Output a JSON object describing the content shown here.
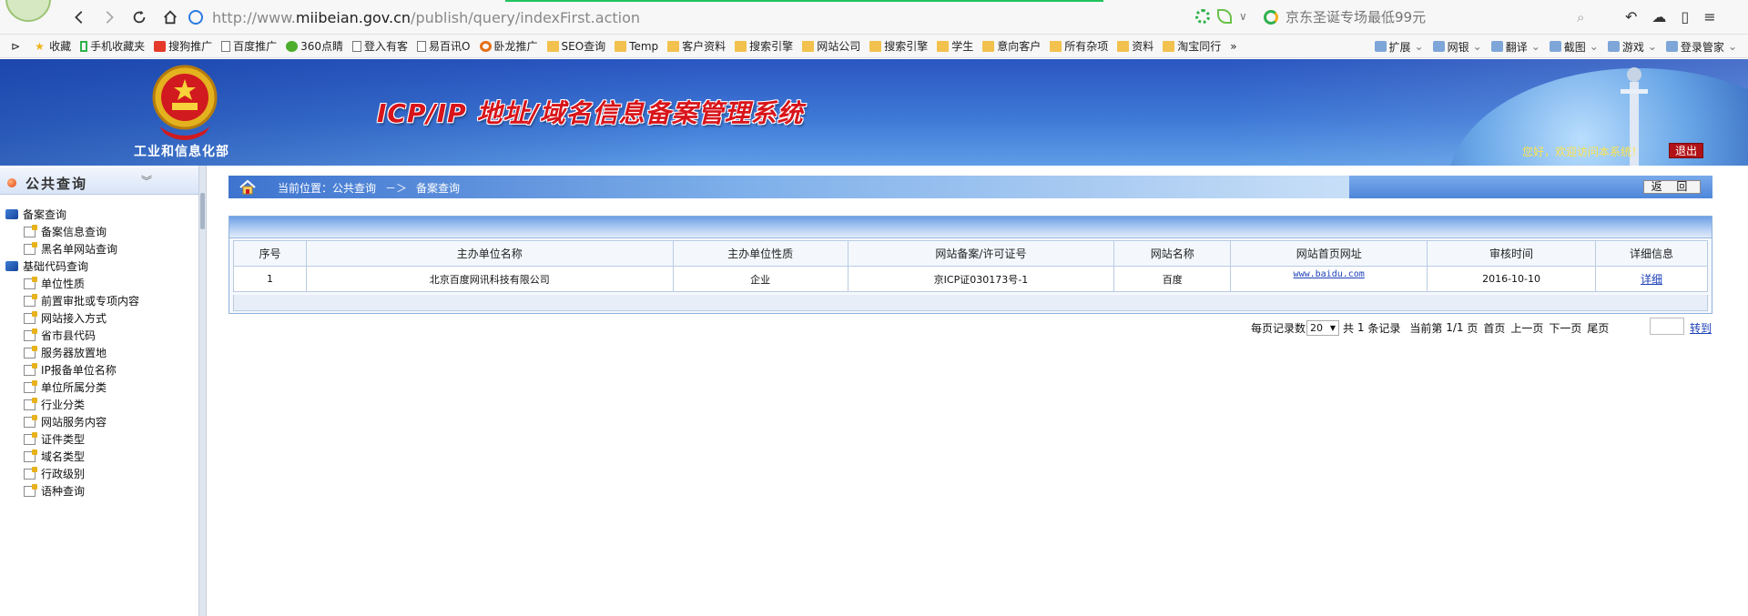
{
  "browser": {
    "url_prefix": "http://www.",
    "url_host": "miibeian.gov.cn",
    "url_path": "/publish/query/indexFirst.action",
    "search_placeholder": "京东圣诞专场最低99元",
    "bookmarks_left": [
      {
        "label": "收藏",
        "icon": "star-icon"
      },
      {
        "label": "手机收藏夹",
        "icon": "phone-icon"
      },
      {
        "label": "搜狗推广",
        "icon": "sogou-icon"
      },
      {
        "label": "百度推广",
        "icon": "page-icon"
      },
      {
        "label": "360点睛",
        "icon": "360-icon"
      },
      {
        "label": "登入有客",
        "icon": "page-icon"
      },
      {
        "label": "易百讯O",
        "icon": "page-icon"
      },
      {
        "label": "卧龙推广",
        "icon": "wolong-icon"
      },
      {
        "label": "SEO查询",
        "icon": "folder-icon"
      },
      {
        "label": "Temp",
        "icon": "folder-icon"
      },
      {
        "label": "客户资料",
        "icon": "folder-icon"
      },
      {
        "label": "搜索引擎",
        "icon": "folder-icon"
      },
      {
        "label": "网站公司",
        "icon": "folder-icon"
      },
      {
        "label": "搜索引擎",
        "icon": "folder-icon"
      },
      {
        "label": "学生",
        "icon": "folder-icon"
      },
      {
        "label": "意向客户",
        "icon": "folder-icon"
      },
      {
        "label": "所有杂项",
        "icon": "folder-icon"
      },
      {
        "label": "资料",
        "icon": "folder-icon"
      },
      {
        "label": "淘宝同行",
        "icon": "folder-icon"
      }
    ],
    "bookmarks_more": "»",
    "bookmarks_right": [
      {
        "label": "扩展",
        "icon": "extension-icon"
      },
      {
        "label": "网银",
        "icon": "bank-icon"
      },
      {
        "label": "翻译",
        "icon": "translate-icon"
      },
      {
        "label": "截图",
        "icon": "screenshot-icon"
      },
      {
        "label": "游戏",
        "icon": "game-icon"
      },
      {
        "label": "登录管家",
        "icon": "login-manager-icon"
      }
    ]
  },
  "header": {
    "ministry": "工业和信息化部",
    "system_title": "ICP/IP 地址/域名信息备案管理系统",
    "welcome": "您好，欢迎访问本系统！",
    "logout": "退出"
  },
  "sidebar": {
    "title": "公共查询",
    "groups": [
      {
        "label": "备案查询",
        "items": [
          "备案信息查询",
          "黑名单网站查询"
        ]
      },
      {
        "label": "基础代码查询",
        "items": [
          "单位性质",
          "前置审批或专项内容",
          "网站接入方式",
          "省市县代码",
          "服务器放置地",
          "IP报备单位名称",
          "单位所属分类",
          "行业分类",
          "网站服务内容",
          "证件类型",
          "域名类型",
          "行政级别",
          "语种查询"
        ]
      }
    ]
  },
  "main": {
    "breadcrumb": {
      "prefix": "当前位置：",
      "section": "公共查询",
      "sep": "－＞",
      "page": "备案查询"
    },
    "back_button": "返 回",
    "table": {
      "headers": [
        "序号",
        "主办单位名称",
        "主办单位性质",
        "网站备案/许可证号",
        "网站名称",
        "网站首页网址",
        "审核时间",
        "详细信息"
      ],
      "rows": [
        {
          "index": "1",
          "org_name": "北京百度网讯科技有限公司",
          "org_type": "企业",
          "license": "京ICP证030173号-1",
          "site_name": "百度",
          "homepage": "www.baidu.com",
          "audit_date": "2016-10-10",
          "detail": "详细"
        }
      ]
    },
    "pager": {
      "per_page_label": "每页记录数",
      "per_page_value": "20",
      "total_prefix": "共",
      "total_count": "1",
      "total_suffix": "条记录",
      "current_label": "当前第",
      "current_page": "1/1",
      "page_suffix": "页",
      "first": "首页",
      "prev": "上一页",
      "next": "下一页",
      "last": "尾页",
      "goto": "转到"
    }
  }
}
